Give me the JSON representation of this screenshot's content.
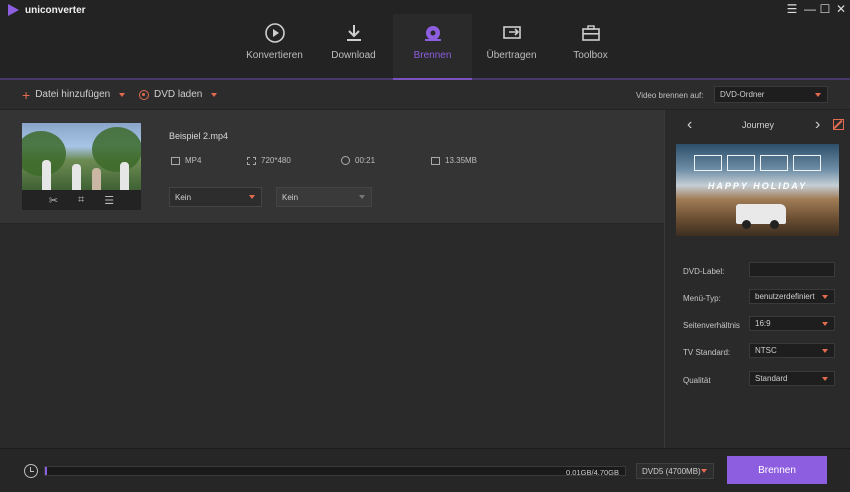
{
  "app": {
    "title": "uniconverter"
  },
  "window_controls": {
    "menu": "☰",
    "minimize": "—",
    "maximize": "☐",
    "close": "✕"
  },
  "nav": {
    "items": [
      {
        "label": "Konvertieren",
        "icon": "convert-icon"
      },
      {
        "label": "Download",
        "icon": "download-icon"
      },
      {
        "label": "Brennen",
        "icon": "burn-disc-icon",
        "active": true
      },
      {
        "label": "Übertragen",
        "icon": "transfer-icon"
      },
      {
        "label": "Toolbox",
        "icon": "toolbox-icon"
      }
    ]
  },
  "toolbar": {
    "add_file": "Datei hinzufügen",
    "load_dvd": "DVD laden",
    "burn_to_label": "Video brennen auf:",
    "burn_to_value": "DVD-Ordner"
  },
  "file": {
    "name": "Beispiel 2.mp4",
    "format": "MP4",
    "resolution": "720*480",
    "duration": "00:21",
    "size": "13.35MB",
    "audio_select": "Kein",
    "subtitle_select": "Kein"
  },
  "template": {
    "name": "Journey",
    "preview_title": "HAPPY HOLIDAY"
  },
  "settings": {
    "dvd_label": {
      "label": "DVD-Label:",
      "value": ""
    },
    "menu_type": {
      "label": "Menü-Typ:",
      "value": "benutzerdefiniert"
    },
    "aspect": {
      "label": "Seitenverhältnis",
      "value": "16:9"
    },
    "tv_standard": {
      "label": "TV Standard:",
      "value": "NTSC"
    },
    "quality": {
      "label": "Qualität",
      "value": "Standard"
    }
  },
  "bottom": {
    "capacity_text": "0.01GB/4.70GB",
    "disc_type": "DVD5 (4700MB)",
    "burn_button": "Brennen",
    "progress_fraction": 0.002
  },
  "colors": {
    "accent": "#8e5ee0",
    "orange": "#e36b4f"
  }
}
